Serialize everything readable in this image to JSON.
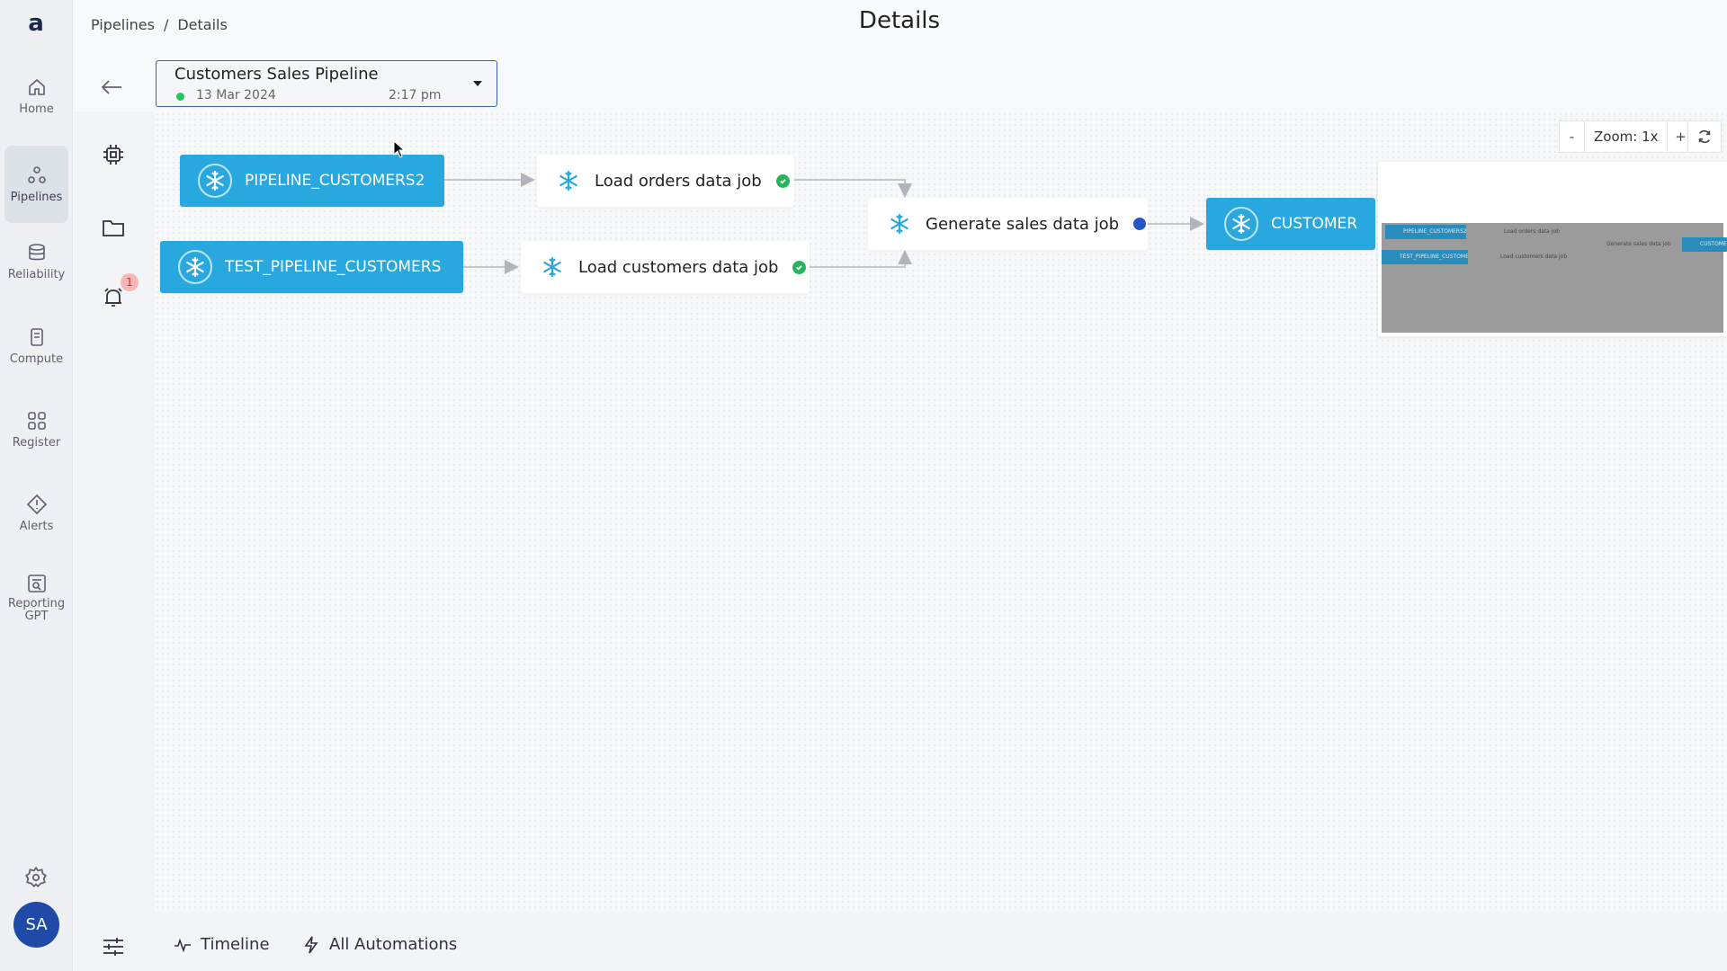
{
  "breadcrumb": {
    "root": "Pipelines",
    "sep": "/",
    "current": "Details"
  },
  "page": {
    "title": "Details"
  },
  "nav": {
    "items": [
      {
        "label": "Home",
        "icon": "home-icon"
      },
      {
        "label": "Pipelines",
        "icon": "pipelines-icon",
        "active": true
      },
      {
        "label": "Reliability",
        "icon": "reliability-icon"
      },
      {
        "label": "Compute",
        "icon": "compute-icon"
      },
      {
        "label": "Register",
        "icon": "register-icon"
      },
      {
        "label": "Alerts",
        "icon": "alerts-icon"
      },
      {
        "label": "Reporting",
        "label2": "GPT",
        "icon": "reporting-gpt-icon"
      }
    ],
    "avatar": "SA"
  },
  "pipeline": {
    "name": "Customers Sales Pipeline",
    "date": "13 Mar 2024",
    "time": "2:17 pm",
    "status_color": "#22c55e"
  },
  "toolbar": {
    "alerts_badge": "1"
  },
  "graph": {
    "sources": [
      {
        "label": "PIPELINE_CUSTOMERS2"
      },
      {
        "label": "TEST_PIPELINE_CUSTOMERS"
      }
    ],
    "jobs": [
      {
        "label": "Load orders data job",
        "status": "success"
      },
      {
        "label": "Load customers data job",
        "status": "success"
      },
      {
        "label": "Generate sales data job",
        "status": "running"
      }
    ],
    "target": {
      "label": "CUSTOMER"
    }
  },
  "zoom": {
    "minus": "-",
    "label": "Zoom: 1x",
    "plus": "+"
  },
  "bottom": {
    "timeline": "Timeline",
    "automations": "All Automations"
  },
  "colors": {
    "accent": "#29a8e0",
    "success": "#22b55a",
    "running": "#2456c8",
    "avatar": "#1f4aa8"
  }
}
